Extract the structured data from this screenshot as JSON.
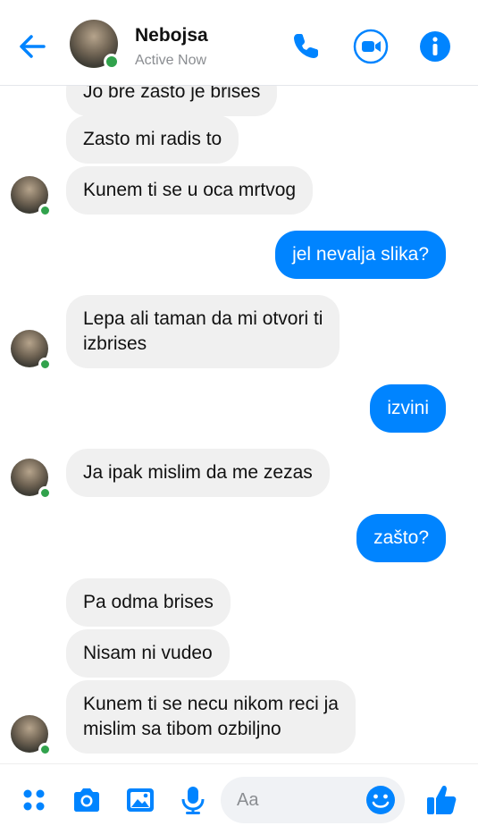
{
  "header": {
    "contact_name": "Nebojsa",
    "status": "Active Now",
    "icons": [
      "back-arrow-icon",
      "phone-icon",
      "video-camera-icon",
      "info-icon"
    ]
  },
  "messages": [
    {
      "from": "them",
      "text": "Jo bre zasto je brises"
    },
    {
      "from": "them",
      "text": "Zasto mi radis to"
    },
    {
      "from": "them",
      "text": "Kunem ti se u oca mrtvog"
    },
    {
      "from": "me",
      "text": "jel nevalja slika?"
    },
    {
      "from": "them",
      "lines": [
        "Lepa ali taman da mi otvori ti",
        "izbrises"
      ]
    },
    {
      "from": "me",
      "text": "izvini"
    },
    {
      "from": "them",
      "text": "Ja ipak mislim da me zezas"
    },
    {
      "from": "me",
      "text": "zašto?"
    },
    {
      "from": "them",
      "text": "Pa odma brises"
    },
    {
      "from": "them",
      "text": "Nisam ni vudeo"
    },
    {
      "from": "them",
      "lines": [
        "Kunem ti se necu nikom reci ja",
        "mislim sa tibom ozbiljno"
      ]
    }
  ],
  "composer": {
    "placeholder": "Aa",
    "icons": [
      "apps-grid-icon",
      "camera-icon",
      "gallery-icon",
      "microphone-icon",
      "emoji-icon",
      "thumbs-up-icon"
    ]
  },
  "colors": {
    "accent": "#0084ff",
    "incoming_bubble": "#f0f0f0",
    "active_dot": "#31a24c"
  }
}
